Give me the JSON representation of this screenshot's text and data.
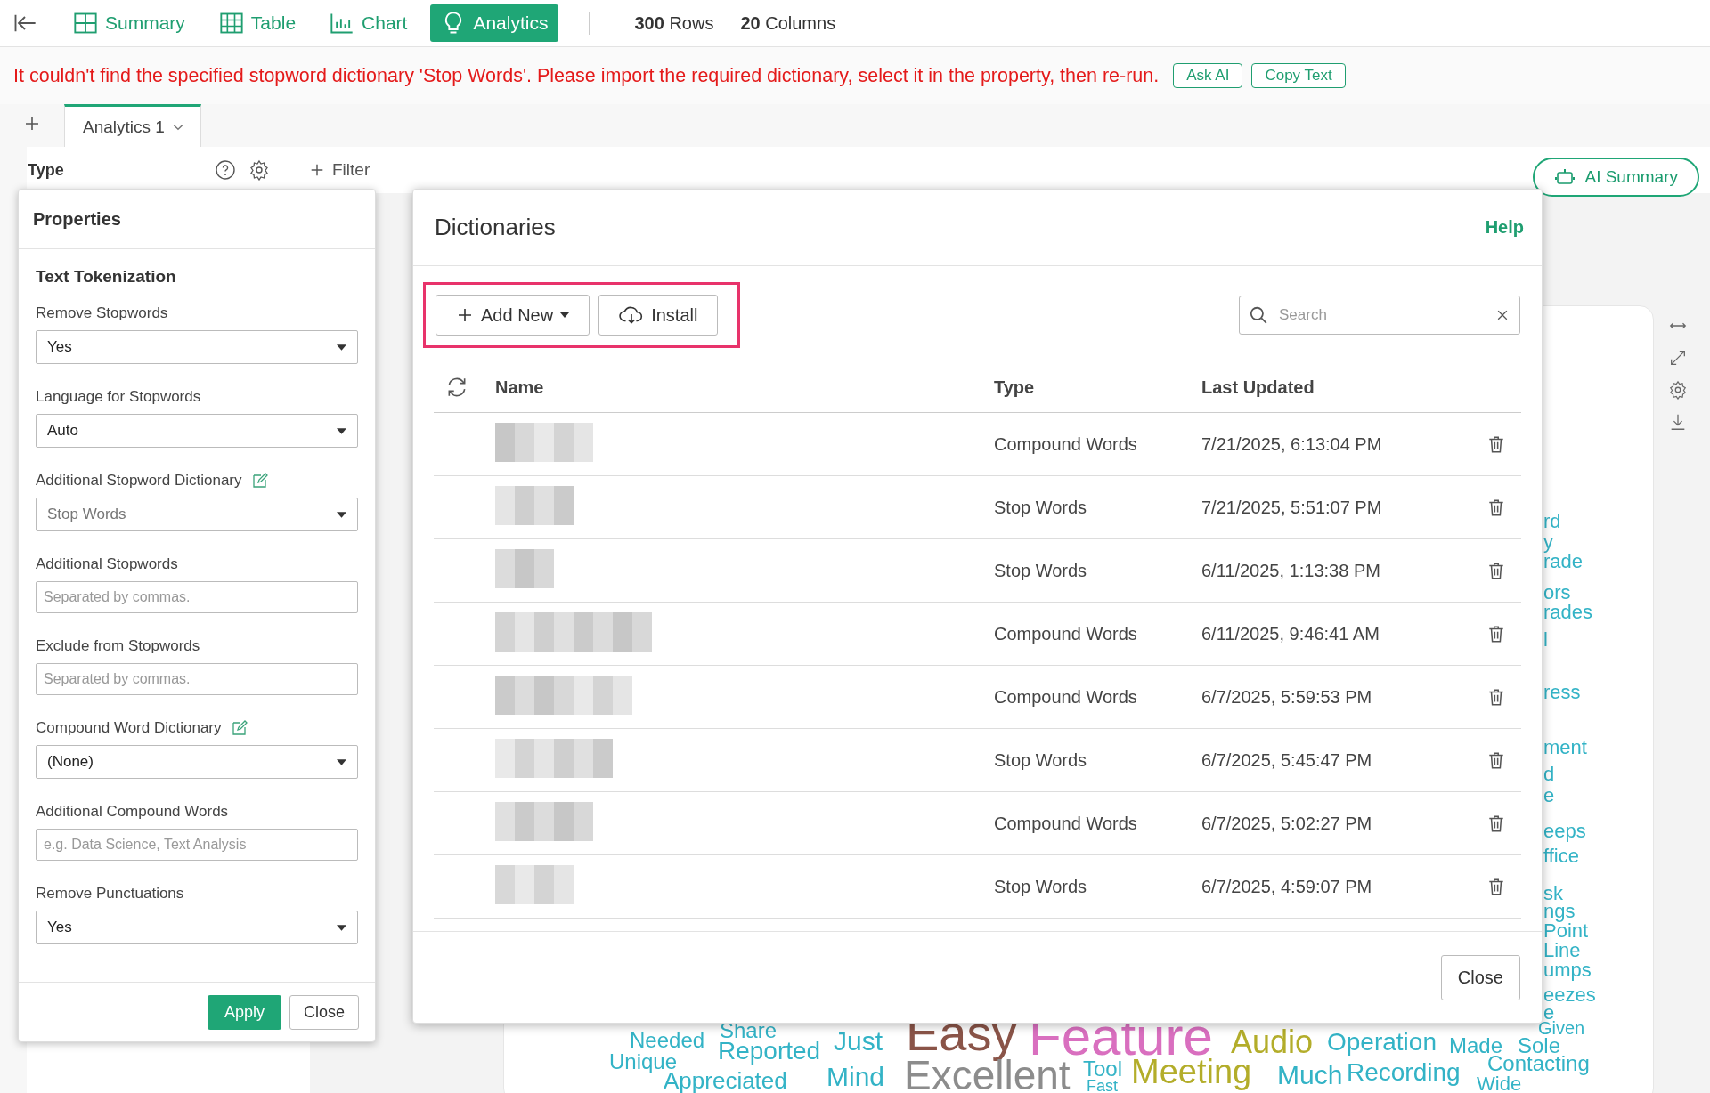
{
  "toolbar": {
    "nav": [
      {
        "label": "Summary",
        "selected": false
      },
      {
        "label": "Table",
        "selected": false
      },
      {
        "label": "Chart",
        "selected": false
      },
      {
        "label": "Analytics",
        "selected": true
      }
    ],
    "stats": [
      {
        "count": "300",
        "unit": "Rows"
      },
      {
        "count": "20",
        "unit": "Columns"
      }
    ]
  },
  "error": {
    "message": "It couldn't find the specified stopword dictionary 'Stop Words'. Please import the required dictionary, select it in the property, then re-run.",
    "buttons": [
      "Ask AI",
      "Copy Text"
    ]
  },
  "tabs": [
    {
      "label": "Analytics 1",
      "selected": true
    }
  ],
  "header": {
    "type_label": "Type",
    "filter": "Filter",
    "ai_summary": "AI Summary"
  },
  "properties": {
    "title": "Properties",
    "section": "Text Tokenization",
    "fields": [
      {
        "kind": "select",
        "label": "Remove Stopwords",
        "value": "Yes",
        "missing": false,
        "edit_icon": false
      },
      {
        "kind": "select",
        "label": "Language for Stopwords",
        "value": "Auto",
        "missing": false,
        "edit_icon": false
      },
      {
        "kind": "select",
        "label": "Additional Stopword Dictionary",
        "value": "Stop Words",
        "missing": true,
        "edit_icon": true
      },
      {
        "kind": "text",
        "label": "Additional Stopwords",
        "placeholder": "Separated by commas."
      },
      {
        "kind": "text",
        "label": "Exclude from Stopwords",
        "placeholder": "Separated by commas."
      },
      {
        "kind": "select",
        "label": "Compound Word Dictionary",
        "value": "(None)",
        "missing": false,
        "edit_icon": true
      },
      {
        "kind": "text",
        "label": "Additional Compound Words",
        "placeholder": "e.g. Data Science, Text Analysis"
      },
      {
        "kind": "select",
        "label": "Remove Punctuations",
        "value": "Yes",
        "missing": false,
        "edit_icon": false
      }
    ],
    "buttons": [
      "Apply",
      "Close"
    ]
  },
  "dialog": {
    "title": "Dictionaries",
    "help": "Help",
    "add_new": "Add New",
    "install": "Install",
    "search": {
      "placeholder": "Search"
    },
    "columns": [
      "Name",
      "Type",
      "Last Updated"
    ],
    "rows": [
      {
        "type": "Compound Words",
        "updated": "7/21/2025, 6:13:04 PM"
      },
      {
        "type": "Stop Words",
        "updated": "7/21/2025, 5:51:07 PM"
      },
      {
        "type": "Stop Words",
        "updated": "6/11/2025, 1:13:38 PM"
      },
      {
        "type": "Compound Words",
        "updated": "6/11/2025, 9:46:41 AM"
      },
      {
        "type": "Compound Words",
        "updated": "6/7/2025, 5:59:53 PM"
      },
      {
        "type": "Stop Words",
        "updated": "6/7/2025, 5:45:47 PM"
      },
      {
        "type": "Compound Words",
        "updated": "6/7/2025, 5:02:27 PM"
      },
      {
        "type": "Stop Words",
        "updated": "6/7/2025, 4:59:07 PM"
      }
    ],
    "close": "Close"
  },
  "word_cloud": {
    "words": [
      {
        "text": "Needed",
        "color": "#33b3c6"
      },
      {
        "text": "Share",
        "color": "#33b3c6"
      },
      {
        "text": "Unique",
        "color": "#33b3c6"
      },
      {
        "text": "Reported",
        "color": "#33b3c6"
      },
      {
        "text": "Just",
        "color": "#33b3c6"
      },
      {
        "text": "Easy",
        "color": "#8a5448"
      },
      {
        "text": "Feature",
        "color": "#d96fbf"
      },
      {
        "text": "Audio",
        "color": "#b3ad2a"
      },
      {
        "text": "Operation",
        "color": "#33b3c6"
      },
      {
        "text": "Made",
        "color": "#33b3c6"
      },
      {
        "text": "Sole",
        "color": "#33b3c6"
      },
      {
        "text": "Given",
        "color": "#33b3c6"
      },
      {
        "text": "Appreciated",
        "color": "#33b3c6"
      },
      {
        "text": "Mind",
        "color": "#33b3c6"
      },
      {
        "text": "Excellent",
        "color": "#8c8c8c"
      },
      {
        "text": "Tool",
        "color": "#33b3c6"
      },
      {
        "text": "Fast",
        "color": "#33b3c6"
      },
      {
        "text": "Meeting",
        "color": "#b3ad2a"
      },
      {
        "text": "Much",
        "color": "#33b3c6"
      },
      {
        "text": "Recording",
        "color": "#33b3c6"
      },
      {
        "text": "Contacting",
        "color": "#33b3c6"
      },
      {
        "text": "Wide",
        "color": "#33b3c6"
      }
    ],
    "fragments": [
      "rd",
      "y",
      "rade",
      "ors",
      "rades",
      "l",
      "ress",
      "ment",
      "d",
      "e",
      "eeps",
      "ffice",
      "sk",
      "ngs",
      "Point",
      "Line",
      "umps",
      "eezes",
      "e"
    ]
  }
}
